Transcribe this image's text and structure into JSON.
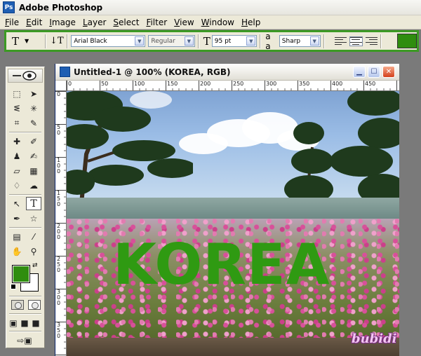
{
  "app": {
    "title": "Adobe Photoshop"
  },
  "menu": [
    "File",
    "Edit",
    "Image",
    "Layer",
    "Select",
    "Filter",
    "View",
    "Window",
    "Help"
  ],
  "options": {
    "tool_glyph": "T",
    "orientation_glyph": "↓T",
    "font_family": "Arial Black",
    "font_style": "Regular",
    "size_glyph": "T",
    "font_size": "95 pt",
    "aa_glyph": "a a",
    "anti_alias": "Sharp",
    "text_color": "#2f8d0f"
  },
  "document": {
    "title": "Untitled-1 @ 100% (KOREA, RGB)",
    "ruler_top": [
      "0",
      "50",
      "100",
      "150",
      "200",
      "250",
      "300",
      "350",
      "400",
      "450"
    ],
    "ruler_left": [
      "0",
      "5\n0",
      "1\n0\n0",
      "1\n5\n0",
      "2\n0\n0",
      "2\n5\n0",
      "3\n0\n0",
      "3\n5\n0"
    ],
    "text_layer": "KOREA",
    "watermark": "bubidi"
  },
  "colors": {
    "foreground": "#2f8d0f",
    "background": "#ffffff",
    "options_border": "#3c9a24"
  }
}
